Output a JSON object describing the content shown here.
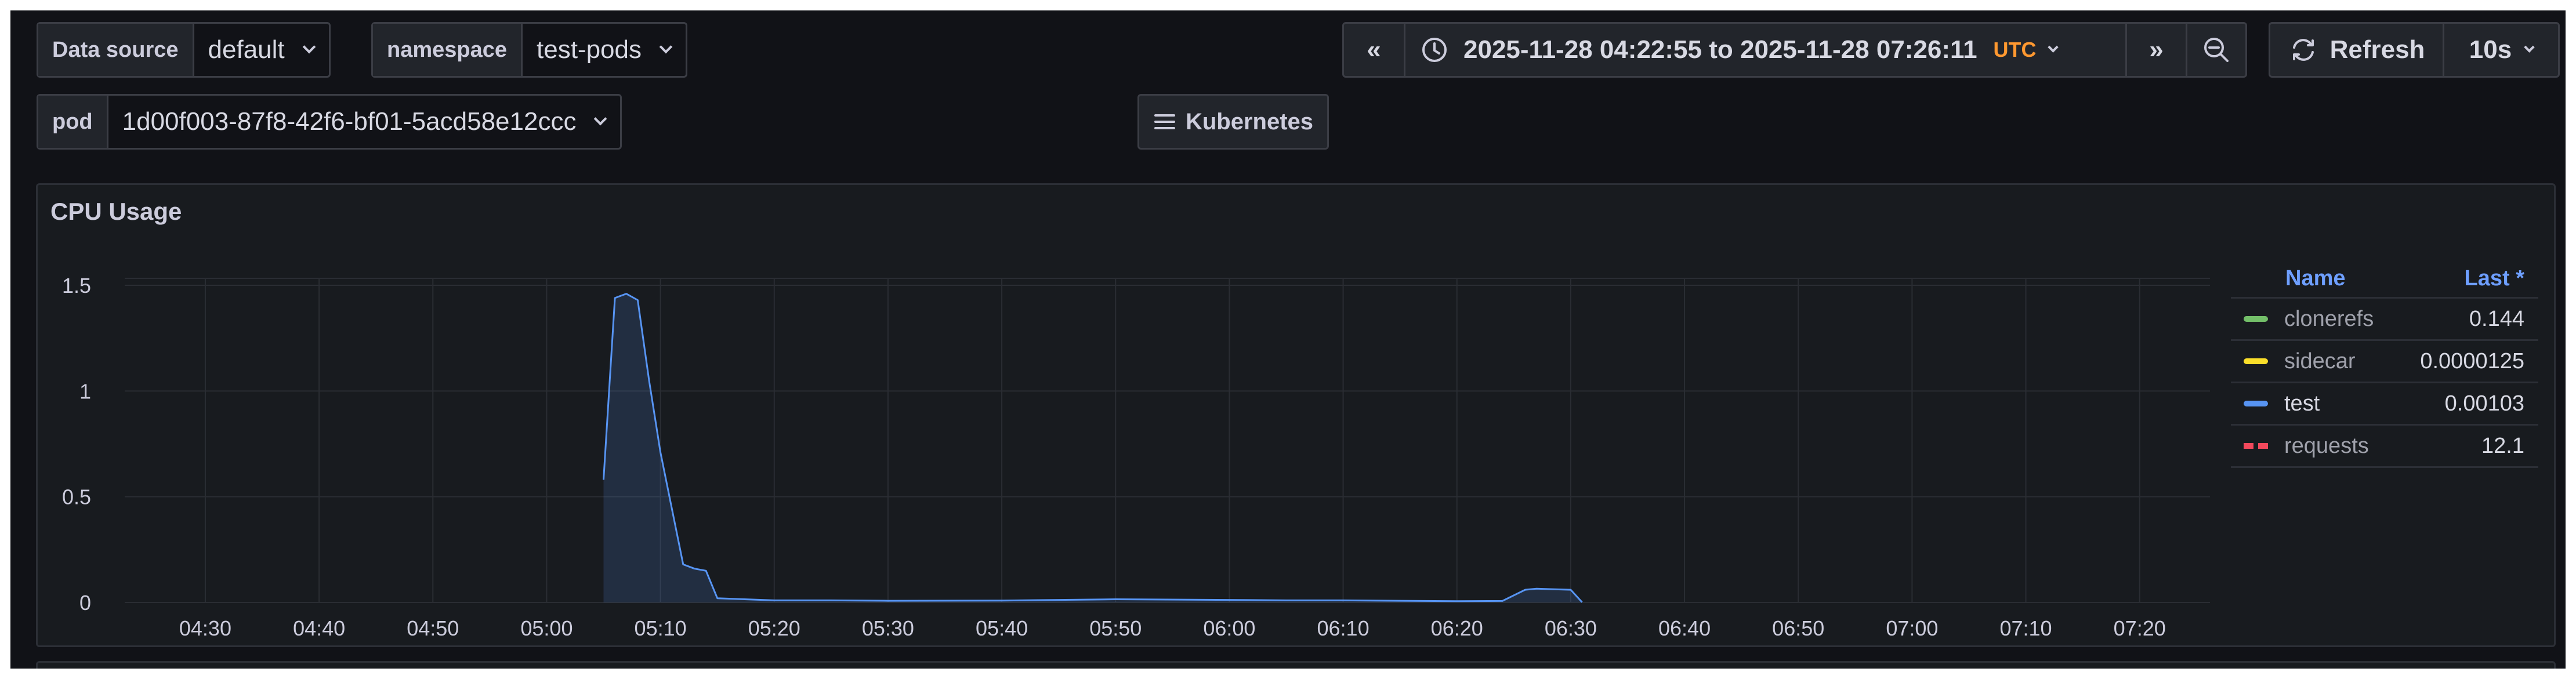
{
  "variables": {
    "datasource": {
      "label": "Data source",
      "value": "default"
    },
    "namespace": {
      "label": "namespace",
      "value": "test-pods"
    },
    "pod": {
      "label": "pod",
      "value": "1d00f003-87f8-42f6-bf01-5acd58e12ccc"
    }
  },
  "kubernetes_button": {
    "label": "Kubernetes"
  },
  "time_picker": {
    "range": "2025-11-28 04:22:55 to 2025-11-28 07:26:11",
    "timezone": "UTC"
  },
  "refresh": {
    "label": "Refresh",
    "interval": "10s"
  },
  "panel": {
    "title": "CPU Usage"
  },
  "legend": {
    "header_name": "Name",
    "header_last": "Last *",
    "items": [
      {
        "name": "clonerefs",
        "value": "0.144",
        "color": "#73bf69",
        "dashed": false
      },
      {
        "name": "sidecar",
        "value": "0.0000125",
        "color": "#fade2a",
        "dashed": false
      },
      {
        "name": "test",
        "value": "0.00103",
        "color": "#5794f2",
        "dashed": false
      },
      {
        "name": "requests",
        "value": "12.1",
        "color": "#f2495c",
        "dashed": true
      }
    ]
  },
  "chart_data": {
    "type": "area",
    "x_ticks": [
      "04:30",
      "04:40",
      "04:50",
      "05:00",
      "05:10",
      "05:20",
      "05:30",
      "05:40",
      "05:50",
      "06:00",
      "06:10",
      "06:20",
      "06:30",
      "06:40",
      "06:50",
      "07:00",
      "07:10",
      "07:20"
    ],
    "y_ticks": [
      "1.5",
      "1",
      "0.5",
      "0"
    ],
    "ylim": [
      0,
      1.5
    ],
    "x_range": [
      "04:22:55",
      "07:26:11"
    ],
    "grid": true,
    "legend_position": "right",
    "series": [
      {
        "name": "test",
        "color": "#5794f2",
        "x": [
          "05:05",
          "05:06",
          "05:07",
          "05:08",
          "05:09",
          "05:10",
          "05:12",
          "05:13",
          "05:14",
          "05:15",
          "05:20",
          "05:25",
          "05:30",
          "05:40",
          "05:45",
          "05:50",
          "06:00",
          "06:05",
          "06:10",
          "06:15",
          "06:20",
          "06:24",
          "06:26",
          "06:27",
          "06:30",
          "06:31"
        ],
        "values": [
          0.58,
          1.44,
          1.46,
          1.43,
          1.05,
          0.71,
          0.18,
          0.16,
          0.15,
          0.02,
          0.01,
          0.01,
          0.008,
          0.009,
          0.012,
          0.015,
          0.012,
          0.01,
          0.01,
          0.008,
          0.006,
          0.007,
          0.06,
          0.065,
          0.06,
          0.001
        ]
      }
    ]
  }
}
